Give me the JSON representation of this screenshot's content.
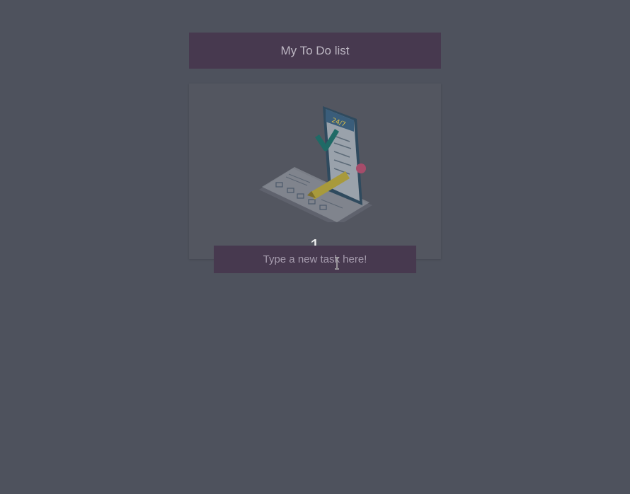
{
  "header": {
    "title": "My To Do list"
  },
  "illustration": {
    "icon": "phone-checklist-illustration",
    "badge": "24/7"
  },
  "task_count": "1",
  "task_input": {
    "placeholder": "Type a new task here!",
    "value": ""
  },
  "colors": {
    "background": "#4e525d",
    "header_bg": "#47394f",
    "card_bg": "#535660",
    "input_bg": "#47394f"
  },
  "cursor": "text-cursor-icon"
}
